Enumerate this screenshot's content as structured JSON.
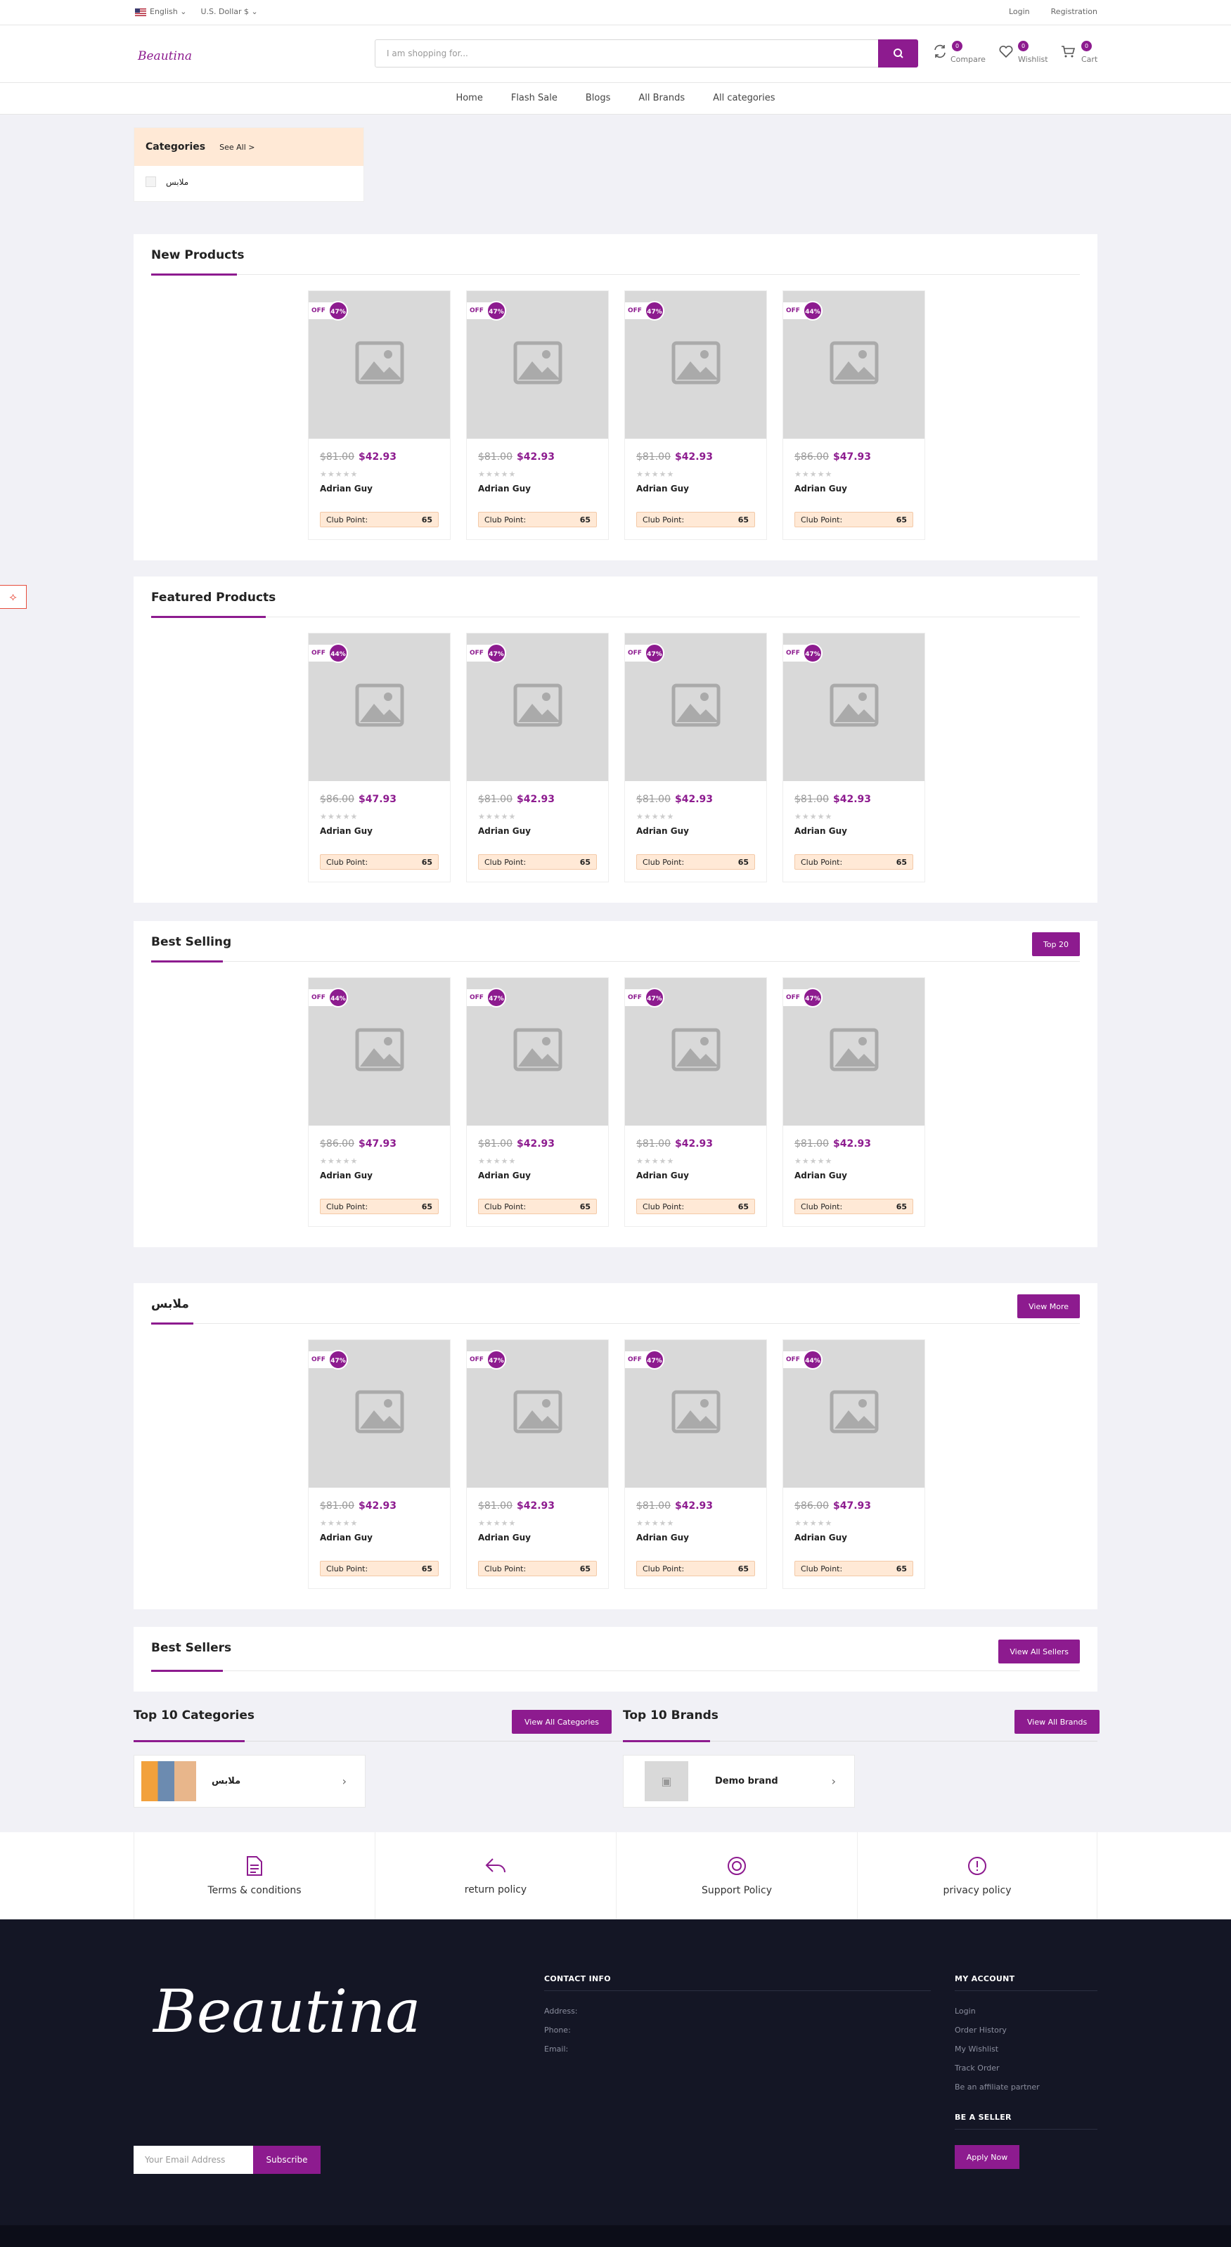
{
  "topbar": {
    "language": "English",
    "currency": "U.S. Dollar $",
    "login": "Login",
    "registration": "Registration"
  },
  "header": {
    "logo": "Beautina",
    "search_placeholder": "I am shopping for...",
    "compare": {
      "label": "Compare",
      "count": "0"
    },
    "wishlist": {
      "label": "Wishlist",
      "count": "0"
    },
    "cart": {
      "label": "Cart",
      "count": "0"
    }
  },
  "nav": [
    "Home",
    "Flash Sale",
    "Blogs",
    "All Brands",
    "All categories"
  ],
  "categories_box": {
    "title": "Categories",
    "see_all": "See All >",
    "items": [
      "ملابس"
    ]
  },
  "sections": [
    {
      "title": "New Products",
      "button": "",
      "products": [
        {
          "off": "47%",
          "old": "$81.00",
          "new": "$42.93",
          "name": "Adrian Guy",
          "club_label": "Club Point:",
          "club_value": "65"
        },
        {
          "off": "47%",
          "old": "$81.00",
          "new": "$42.93",
          "name": "Adrian Guy",
          "club_label": "Club Point:",
          "club_value": "65"
        },
        {
          "off": "47%",
          "old": "$81.00",
          "new": "$42.93",
          "name": "Adrian Guy",
          "club_label": "Club Point:",
          "club_value": "65"
        },
        {
          "off": "44%",
          "old": "$86.00",
          "new": "$47.93",
          "name": "Adrian Guy",
          "club_label": "Club Point:",
          "club_value": "65"
        }
      ]
    },
    {
      "title": "Featured Products",
      "button": "",
      "products": [
        {
          "off": "44%",
          "old": "$86.00",
          "new": "$47.93",
          "name": "Adrian Guy",
          "club_label": "Club Point:",
          "club_value": "65"
        },
        {
          "off": "47%",
          "old": "$81.00",
          "new": "$42.93",
          "name": "Adrian Guy",
          "club_label": "Club Point:",
          "club_value": "65"
        },
        {
          "off": "47%",
          "old": "$81.00",
          "new": "$42.93",
          "name": "Adrian Guy",
          "club_label": "Club Point:",
          "club_value": "65"
        },
        {
          "off": "47%",
          "old": "$81.00",
          "new": "$42.93",
          "name": "Adrian Guy",
          "club_label": "Club Point:",
          "club_value": "65"
        }
      ]
    },
    {
      "title": "Best Selling",
      "button": "Top 20",
      "products": [
        {
          "off": "44%",
          "old": "$86.00",
          "new": "$47.93",
          "name": "Adrian Guy",
          "club_label": "Club Point:",
          "club_value": "65"
        },
        {
          "off": "47%",
          "old": "$81.00",
          "new": "$42.93",
          "name": "Adrian Guy",
          "club_label": "Club Point:",
          "club_value": "65"
        },
        {
          "off": "47%",
          "old": "$81.00",
          "new": "$42.93",
          "name": "Adrian Guy",
          "club_label": "Club Point:",
          "club_value": "65"
        },
        {
          "off": "47%",
          "old": "$81.00",
          "new": "$42.93",
          "name": "Adrian Guy",
          "club_label": "Club Point:",
          "club_value": "65"
        }
      ]
    },
    {
      "title": "ملابس",
      "button": "View More",
      "products": [
        {
          "off": "47%",
          "old": "$81.00",
          "new": "$42.93",
          "name": "Adrian Guy",
          "club_label": "Club Point:",
          "club_value": "65"
        },
        {
          "off": "47%",
          "old": "$81.00",
          "new": "$42.93",
          "name": "Adrian Guy",
          "club_label": "Club Point:",
          "club_value": "65"
        },
        {
          "off": "47%",
          "old": "$81.00",
          "new": "$42.93",
          "name": "Adrian Guy",
          "club_label": "Club Point:",
          "club_value": "65"
        },
        {
          "off": "44%",
          "old": "$86.00",
          "new": "$47.93",
          "name": "Adrian Guy",
          "club_label": "Club Point:",
          "club_value": "65"
        }
      ]
    }
  ],
  "off_label": "OFF",
  "best_sellers": {
    "title": "Best Sellers",
    "button": "View All Sellers"
  },
  "top_categories": {
    "title": "Top 10 Categories",
    "button": "View All Categories",
    "item": "ملابس"
  },
  "top_brands": {
    "title": "Top 10 Brands",
    "button": "View All Brands",
    "item": "Demo brand"
  },
  "policies": [
    "Terms & conditions",
    "return policy",
    "Support Policy",
    "privacy policy"
  ],
  "footer": {
    "logo": "Beautina",
    "email_placeholder": "Your Email Address",
    "subscribe": "Subscribe",
    "contact_title": "CONTACT INFO",
    "contact": [
      "Address:",
      "Phone:",
      "Email:"
    ],
    "account_title": "MY ACCOUNT",
    "account": [
      "Login",
      "Order History",
      "My Wishlist",
      "Track Order",
      "Be an affiliate partner"
    ],
    "seller_title": "BE A SELLER",
    "apply": "Apply Now"
  },
  "colors": {
    "brand": "#8d1b8f",
    "footer_bg": "#141625",
    "club_bg": "#ffe9d6"
  }
}
